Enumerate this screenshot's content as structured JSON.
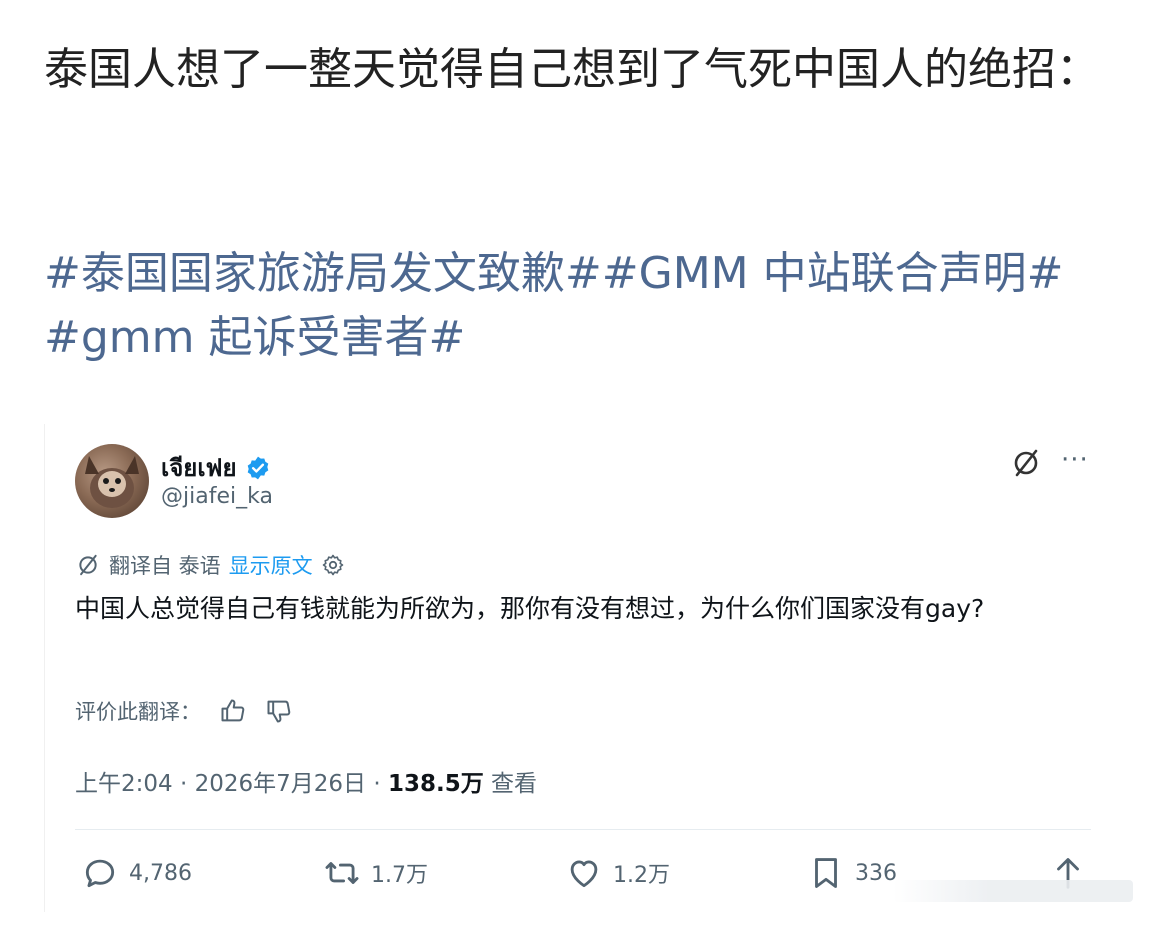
{
  "post": {
    "text": "泰国人想了一整天觉得自己想到了气死中国人的绝招：",
    "hashtags": [
      "#泰国国家旅游局发文致歉#",
      "#GMM 中站联合声明#",
      "#gmm 起诉受害者#"
    ]
  },
  "tweet": {
    "display_name": "เจียเฟย",
    "handle": "@jiafei_ka",
    "translate": {
      "from_label": "翻译自 泰语",
      "show_original": "显示原文"
    },
    "body": "中国人总觉得自己有钱就能为所欲为，那你有没有想过，为什么你们国家没有gay?",
    "rate_label": "评价此翻译：",
    "timestamp": "上午2:04 · 2026年7月26日 · ",
    "views_count": "138.5万",
    "views_label": " 查看",
    "actions": {
      "replies": "4,786",
      "retweets": "1.7万",
      "likes": "1.2万",
      "bookmarks": "336"
    }
  },
  "colors": {
    "hashtag": "#4d6890",
    "verified": "#1d9bf0",
    "link": "#1d9bf0",
    "secondary_text": "#536471"
  },
  "icons": [
    "verified-badge-icon",
    "grok-icon",
    "more-icon",
    "translate-icon",
    "settings-icon",
    "thumbs-up-icon",
    "thumbs-down-icon",
    "reply-icon",
    "retweet-icon",
    "like-icon",
    "bookmark-icon",
    "share-icon"
  ]
}
